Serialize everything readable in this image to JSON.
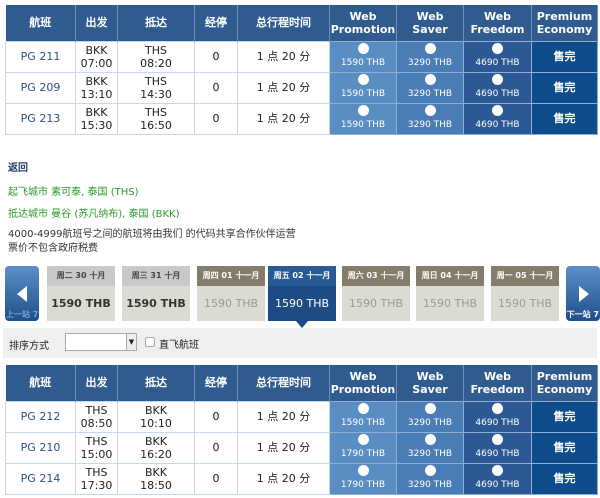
{
  "headers": {
    "flight": "航班",
    "depart": "出发",
    "arrive": "抵达",
    "stops": "经停",
    "duration": "总行程时间",
    "promo": "Web Promotion",
    "saver": "Web Saver",
    "freedom": "Web Freedom",
    "premium": "Premium Economy"
  },
  "outbound": [
    {
      "flight": "PG 211",
      "from": "BKK",
      "dep": "07:00",
      "to": "THS",
      "arr": "08:20",
      "stops": "0",
      "duration": "1 点 20 分",
      "promo": "1590 THB",
      "saver": "3290 THB",
      "freedom": "4690 THB",
      "premium": "售完"
    },
    {
      "flight": "PG 209",
      "from": "BKK",
      "dep": "13:10",
      "to": "THS",
      "arr": "14:30",
      "stops": "0",
      "duration": "1 点 20 分",
      "promo": "1590 THB",
      "saver": "3290 THB",
      "freedom": "4690 THB",
      "premium": "售完"
    },
    {
      "flight": "PG 213",
      "from": "BKK",
      "dep": "15:30",
      "to": "THS",
      "arr": "16:50",
      "stops": "0",
      "duration": "1 点 20 分",
      "promo": "1590 THB",
      "saver": "3290 THB",
      "freedom": "4690 THB",
      "premium": "售完"
    }
  ],
  "info": {
    "back": "返回",
    "origin": "起飞城市 素可泰, 泰国 (THS)",
    "destination": "抵达城市 曼谷 (苏凡纳布), 泰国 (BKK)",
    "note1": "4000-4999航班号之间的航班将由我们 的代码共享合作伙伴运营",
    "note2": "票价不包含政府税费"
  },
  "dates": {
    "prev": "上一站 7",
    "next": "下一站 7",
    "tiles": [
      {
        "label": "周二 30 十月",
        "price": "1590 THB",
        "state": "past"
      },
      {
        "label": "周三 31 十月",
        "price": "1590 THB",
        "state": "past"
      },
      {
        "label": "周四 01 十一月",
        "price": "1590 THB",
        "state": "normal"
      },
      {
        "label": "周五 02 十一月",
        "price": "1590 THB",
        "state": "sel"
      },
      {
        "label": "周六 03 十一月",
        "price": "1590 THB",
        "state": "normal"
      },
      {
        "label": "周日 04 十一月",
        "price": "1590 THB",
        "state": "normal"
      },
      {
        "label": "周一 05 十一月",
        "price": "1590 THB",
        "state": "normal"
      }
    ]
  },
  "sort": {
    "label": "排序方式",
    "value": "",
    "direct": "直飞航班"
  },
  "return": [
    {
      "flight": "PG 212",
      "from": "THS",
      "dep": "08:50",
      "to": "BKK",
      "arr": "10:10",
      "stops": "0",
      "duration": "1 点 20 分",
      "promo": "1590 THB",
      "saver": "3290 THB",
      "freedom": "4690 THB",
      "premium": "售完"
    },
    {
      "flight": "PG 210",
      "from": "THS",
      "dep": "15:00",
      "to": "BKK",
      "arr": "16:20",
      "stops": "0",
      "duration": "1 点 20 分",
      "promo": "1790 THB",
      "saver": "3290 THB",
      "freedom": "4690 THB",
      "premium": "售完"
    },
    {
      "flight": "PG 214",
      "from": "THS",
      "dep": "17:30",
      "to": "BKK",
      "arr": "18:50",
      "stops": "0",
      "duration": "1 点 20 分",
      "promo": "1790 THB",
      "saver": "3290 THB",
      "freedom": "4690 THB",
      "premium": "售完"
    }
  ]
}
